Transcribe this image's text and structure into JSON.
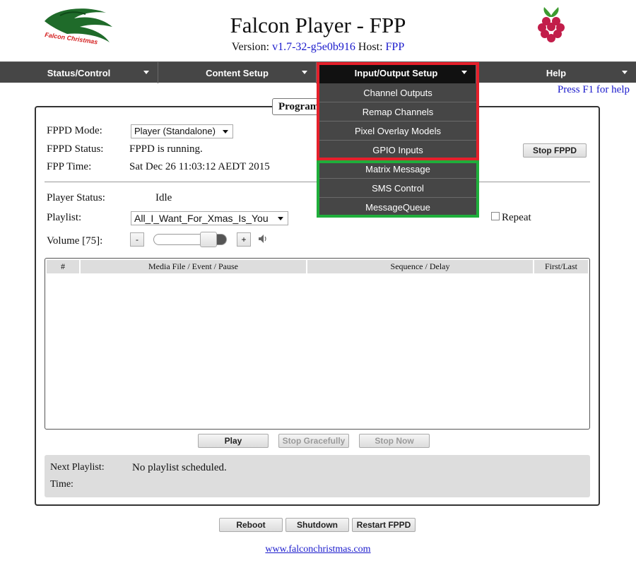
{
  "header": {
    "title": "Falcon Player - FPP",
    "version_label": "Version:",
    "version": "v1.7-32-g5e0b916",
    "host_label": "Host:",
    "host": "FPP",
    "logo_text": "Falcon Christmas"
  },
  "nav": {
    "items": [
      {
        "label": "Status/Control"
      },
      {
        "label": "Content Setup"
      },
      {
        "label": "Input/Output Setup"
      },
      {
        "label": "Help"
      }
    ],
    "help_hint": "Press F1 for help"
  },
  "dropdown": {
    "items": [
      {
        "label": "Channel Outputs"
      },
      {
        "label": "Remap Channels"
      },
      {
        "label": "Pixel Overlay Models"
      },
      {
        "label": "GPIO Inputs"
      },
      {
        "label": "Matrix Message"
      },
      {
        "label": "SMS Control"
      },
      {
        "label": "MessageQueue"
      }
    ],
    "highlight_colors": {
      "red": "#e5202b",
      "green": "#1fae3b"
    }
  },
  "panel": {
    "legend": "Program",
    "mode_label": "FPPD Mode:",
    "mode_value": "Player (Standalone)",
    "status_label": "FPPD Status:",
    "status_value": "FPPD is running.",
    "stop_fppd": "Stop FPPD",
    "time_label": "FPP Time:",
    "time_value": "Sat Dec 26 11:03:12 AEDT 2015",
    "player_status_label": "Player Status:",
    "player_status_value": "Idle",
    "playlist_label": "Playlist:",
    "playlist_value": "All_I_Want_For_Xmas_Is_You",
    "repeat_label": "Repeat",
    "volume_label": "Volume [75]:",
    "volume_level": 75,
    "vol_minus": "-",
    "vol_plus": "+",
    "table_headers": [
      "#",
      "Media File / Event / Pause",
      "Sequence / Delay",
      "First/Last"
    ],
    "play": "Play",
    "stop_gracefully": "Stop Gracefully",
    "stop_now": "Stop Now",
    "next_playlist_label": "Next Playlist:",
    "next_playlist_value": "No playlist scheduled.",
    "next_time_label": "Time:"
  },
  "footer": {
    "reboot": "Reboot",
    "shutdown": "Shutdown",
    "restart": "Restart FPPD",
    "link": "www.falconchristmas.com"
  }
}
